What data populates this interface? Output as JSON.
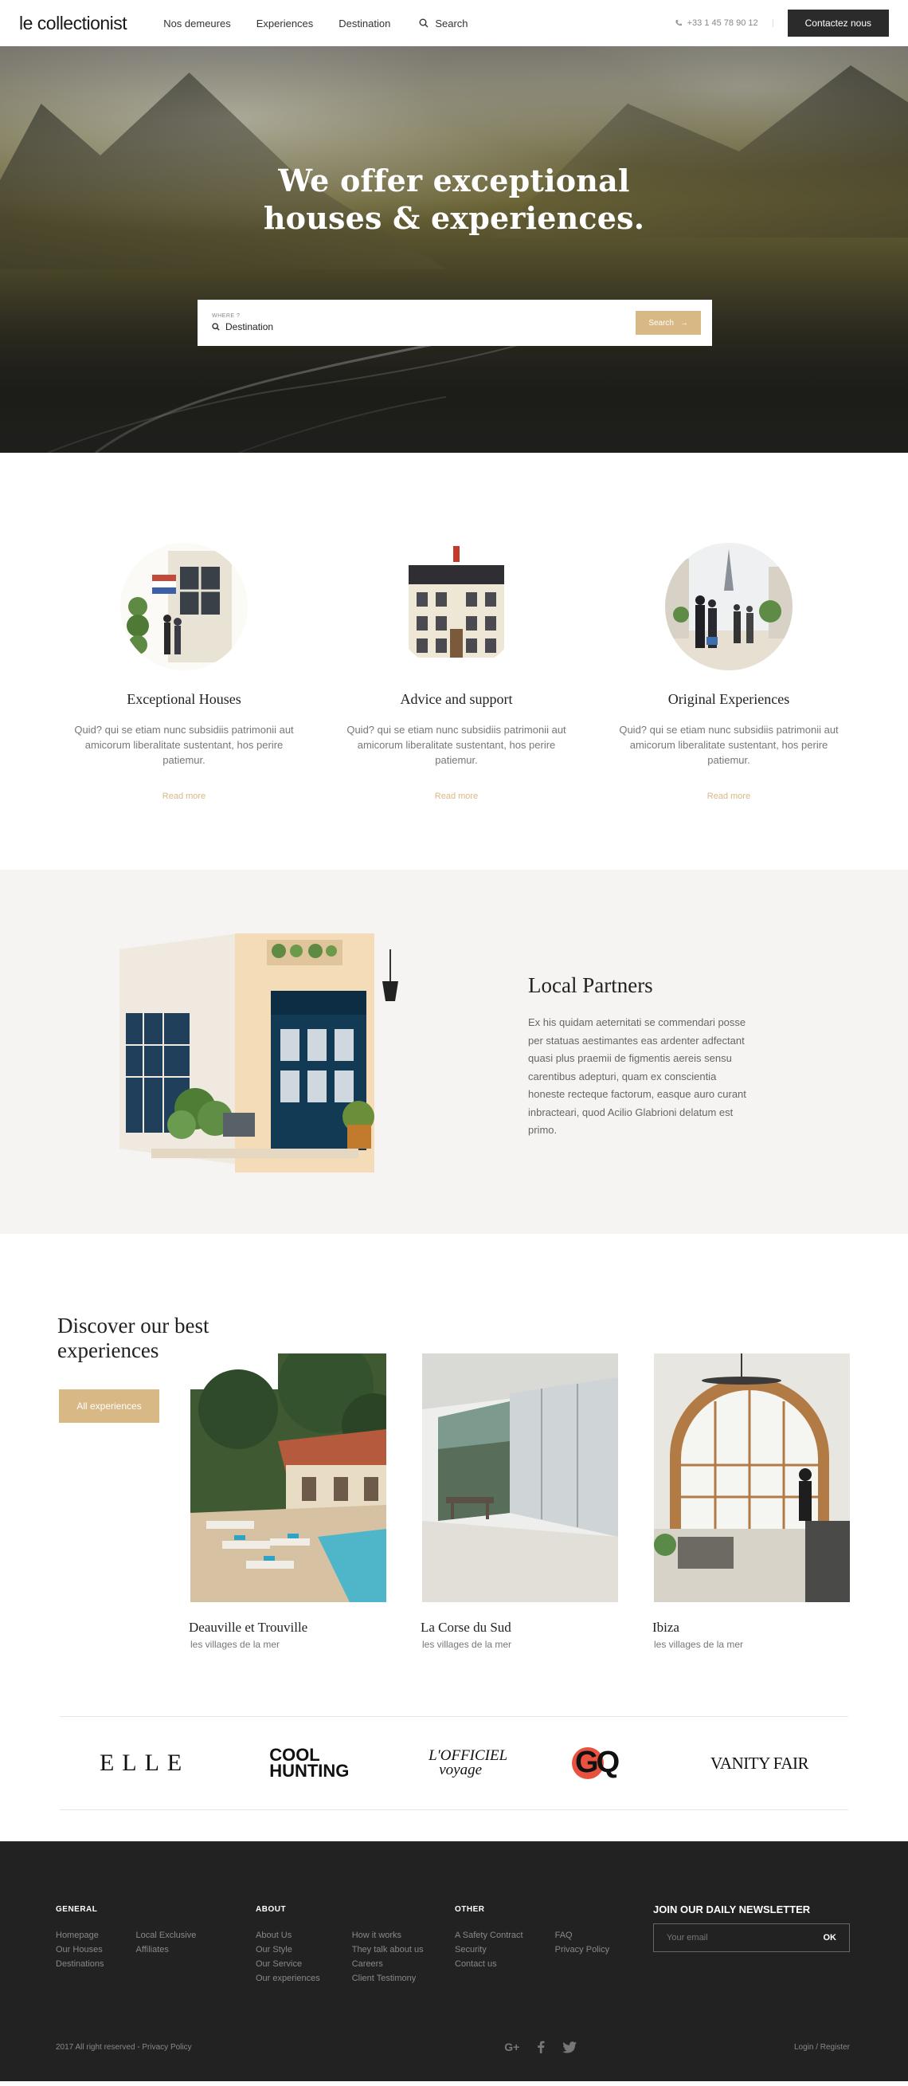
{
  "header": {
    "logo": "le collectionist",
    "nav": [
      "Nos demeures",
      "Experiences",
      "Destination"
    ],
    "search_label": "Search",
    "phone": "+33 1 45 78 90 12",
    "contact_button": "Contactez nous"
  },
  "hero": {
    "title_line1": "We offer exceptional",
    "title_line2": "houses & experiences.",
    "search_label": "WHERE ?",
    "search_value": "Destination",
    "search_button": "Search"
  },
  "features": [
    {
      "title": "Exceptional Houses",
      "text": "Quid? qui se etiam nunc subsidiis patrimonii aut amicorum liberalitate sustentant, hos perire patiemur.",
      "link": "Read more"
    },
    {
      "title": "Advice and support",
      "text": "Quid? qui se etiam nunc subsidiis patrimonii aut amicorum liberalitate sustentant, hos perire patiemur.",
      "link": "Read more"
    },
    {
      "title": "Original Experiences",
      "text": "Quid? qui se etiam nunc subsidiis patrimonii aut amicorum liberalitate sustentant, hos perire patiemur.",
      "link": "Read more"
    }
  ],
  "partners": {
    "title": "Local Partners",
    "body": "Ex his quidam aeternitati se commendari posse per statuas aestimantes eas ardenter adfectant quasi plus praemii de figmentis aereis sensu carentibus adepturi, quam ex conscientia honeste recteque factorum, easque auro curant inbracteari, quod Acilio Glabrioni delatum est primo."
  },
  "experiences": {
    "title": "Discover our best experiences",
    "button": "All experiences",
    "cards": [
      {
        "name": "Deauville et Trouville",
        "sub": "les villages de la mer"
      },
      {
        "name": "La Corse du Sud",
        "sub": "les villages de la mer"
      },
      {
        "name": "Ibiza",
        "sub": "les villages de la mer"
      }
    ]
  },
  "press": [
    "ELLE",
    "COOL HUNTING",
    "L'OFFICIEL voyage",
    "GQ",
    "VANITY FAIR"
  ],
  "footer": {
    "general": {
      "heading": "GENERAL",
      "col1": [
        "Homepage",
        "Our Houses",
        "Destinations"
      ],
      "col2": [
        "Local Exclusive",
        "Affiliates"
      ]
    },
    "about": {
      "heading": "ABOUT",
      "col1": [
        "About Us",
        "Our Style",
        "Our Service",
        "Our experiences"
      ],
      "col2": [
        "How it works",
        "They talk about us",
        "Careers",
        "Client Testimony"
      ]
    },
    "other": {
      "heading": "OTHER",
      "col1": [
        "A Safety Contract",
        "Security",
        "Contact us"
      ],
      "col2": [
        "FAQ",
        "Privacy Policy"
      ]
    },
    "newsletter": {
      "heading": "JOIN OUR DAILY NEWSLETTER",
      "placeholder": "Your email",
      "button": "OK"
    },
    "copyright": "2017 All right reserved - Privacy Policy",
    "login": "Login / Register",
    "social_icons": [
      "google-plus-icon",
      "facebook-icon",
      "twitter-icon"
    ]
  },
  "colors": {
    "accent": "#d8b885",
    "dark": "#222222",
    "partners_bg": "#f5f4f2"
  }
}
